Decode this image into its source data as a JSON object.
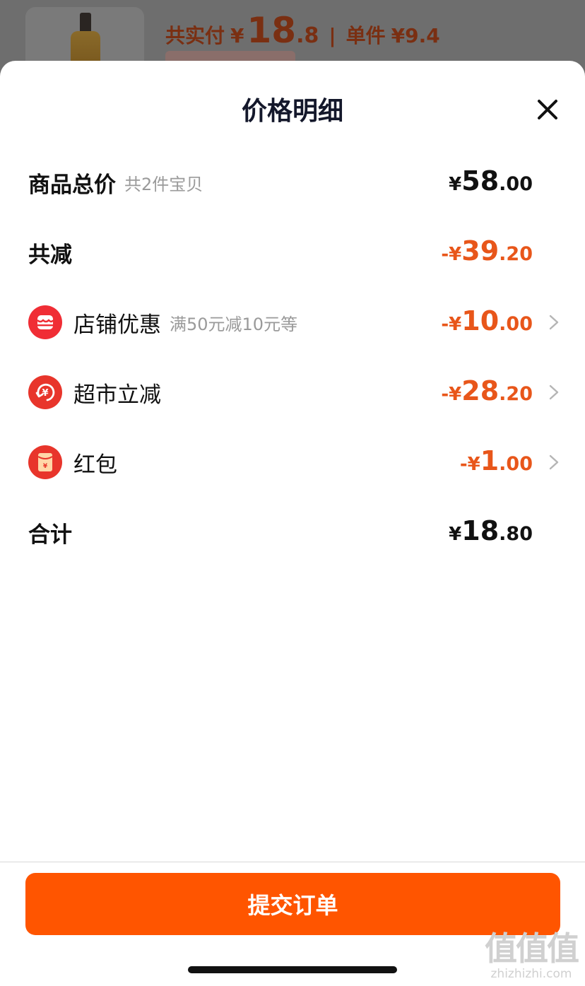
{
  "background": {
    "price_label": "共实付",
    "currency": "¥",
    "price_int": "18",
    "price_dec": ".8",
    "separator": "|",
    "unit_label": "单件",
    "unit_price": "¥9.4"
  },
  "sheet": {
    "title": "价格明细",
    "close_icon": "close-icon"
  },
  "rows": {
    "total_goods": {
      "label": "商品总价",
      "sub": "共2件宝贝",
      "cur": "¥",
      "int": "58",
      "dec": ".00"
    },
    "total_discount": {
      "label": "共减",
      "cur": "-¥",
      "int": "39",
      "dec": ".20"
    },
    "shop_discount": {
      "icon": "store-icon",
      "label": "店铺优惠",
      "sub": "满50元减10元等",
      "cur": "-¥",
      "int": "10",
      "dec": ".00"
    },
    "market_discount": {
      "icon": "yuan-refresh-icon",
      "label": "超市立减",
      "cur": "-¥",
      "int": "28",
      "dec": ".20"
    },
    "red_packet": {
      "icon": "red-packet-icon",
      "label": "红包",
      "cur": "-¥",
      "int": "1",
      "dec": ".00"
    },
    "grand_total": {
      "label": "合计",
      "cur": "¥",
      "int": "18",
      "dec": ".80"
    }
  },
  "footer": {
    "submit_label": "提交订单",
    "watermark_main": "值值值",
    "watermark_sub": "zhizhizhi.com"
  },
  "colors": {
    "accent": "#ff5500",
    "discount": "#e8561a",
    "icon_red": "#f02d35"
  }
}
